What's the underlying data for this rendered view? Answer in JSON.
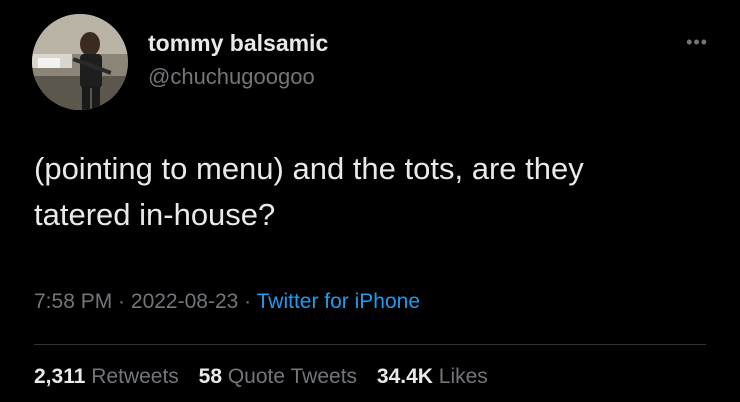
{
  "user": {
    "display_name": "tommy balsamic",
    "handle": "@chuchugoogoo"
  },
  "menu_icon": "more-dots-icon",
  "tweet": {
    "text": "(pointing to menu) and the tots, are they tatered in-house?"
  },
  "meta": {
    "time": "7:58 PM",
    "sep1": " · ",
    "date": "2022-08-23",
    "sep2": " · ",
    "source": "Twitter for iPhone"
  },
  "stats": {
    "retweets_count": "2,311",
    "retweets_label": "Retweets",
    "quotes_count": "58",
    "quotes_label": "Quote Tweets",
    "likes_count": "34.4K",
    "likes_label": "Likes"
  },
  "colors": {
    "background": "#000000",
    "primary_text": "#e7e9ea",
    "secondary_text": "#71767b",
    "link": "#1d9bf0",
    "divider": "#2f3336"
  }
}
